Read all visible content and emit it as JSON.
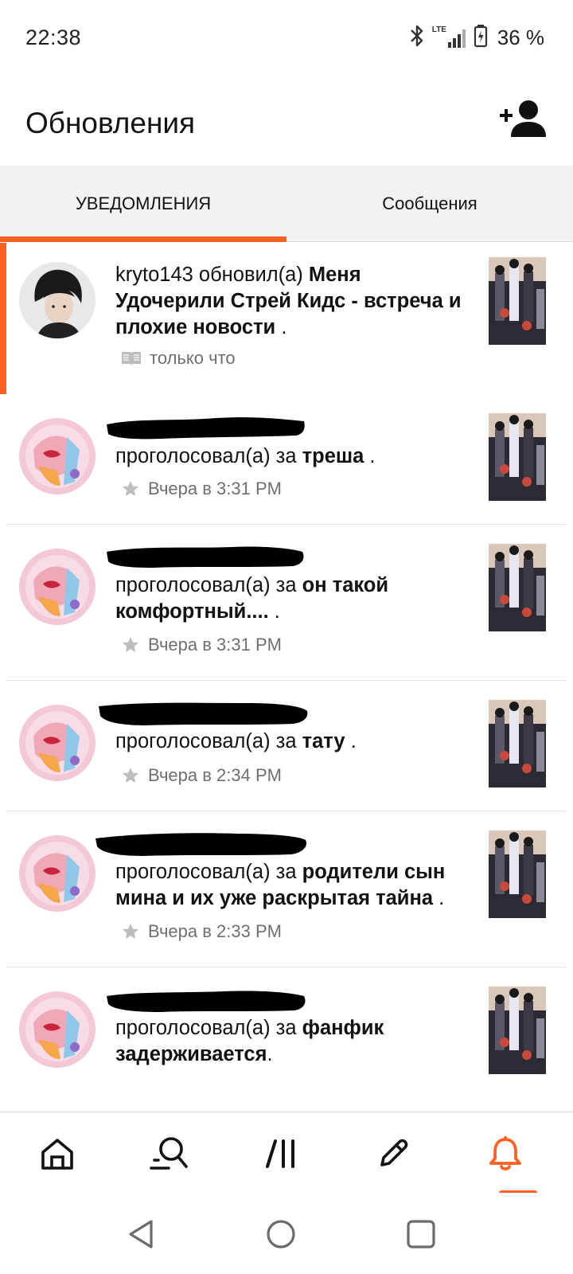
{
  "status_bar": {
    "time": "22:38",
    "network_label": "LTE",
    "battery_text": "36 %",
    "icons": [
      "bluetooth-icon",
      "lte-signal-icon",
      "battery-icon"
    ]
  },
  "header": {
    "title": "Обновления",
    "add_friend_icon": "add-person-icon"
  },
  "tabs": [
    {
      "label": "УВЕДОМЛЕНИЯ",
      "active": true
    },
    {
      "label": "Сообщения",
      "active": false
    }
  ],
  "notifications": [
    {
      "user": "kryto143",
      "action": " обновил(а) ",
      "story": "Меня Удочерили Стрей Кидс - встреча и плохие новости",
      "suffix": " .",
      "time": "только что",
      "meta_icon": "book-icon",
      "unread": true
    },
    {
      "action": "проголосовал(а) за ",
      "story": "треша",
      "suffix": " .",
      "time": "Вчера в 3:31 PM",
      "meta_icon": "star-icon",
      "unread": false
    },
    {
      "action": "проголосовал(а) за ",
      "story": "он такой комфортный....",
      "suffix": " .",
      "time": "Вчера в 3:31 PM",
      "meta_icon": "star-icon",
      "unread": false
    },
    {
      "action": "проголосовал(а) за ",
      "story": "тату",
      "suffix": " .",
      "time": "Вчера в 2:34 PM",
      "meta_icon": "star-icon",
      "unread": false
    },
    {
      "action": "проголосовал(а) за ",
      "story": "родители сын мина и их уже раскрытая тайна",
      "suffix": " .",
      "time": "Вчера в 2:33 PM",
      "meta_icon": "star-icon",
      "unread": false
    },
    {
      "action": "проголосовал(а) за ",
      "story": "фанфик задерживается",
      "suffix": ".",
      "time": "",
      "meta_icon": "",
      "unread": false
    }
  ],
  "bottom_nav": [
    {
      "icon": "home-icon",
      "active": false
    },
    {
      "icon": "search-icon",
      "active": false
    },
    {
      "icon": "library-icon",
      "active": false
    },
    {
      "icon": "pencil-icon",
      "active": false
    },
    {
      "icon": "bell-icon",
      "active": true
    }
  ],
  "system_nav": [
    "back-icon",
    "home-circle-icon",
    "recents-icon"
  ],
  "colors": {
    "accent": "#ff6122",
    "text": "#121212",
    "muted": "#6f6f6f",
    "tab_bg": "#f2f2f3"
  }
}
